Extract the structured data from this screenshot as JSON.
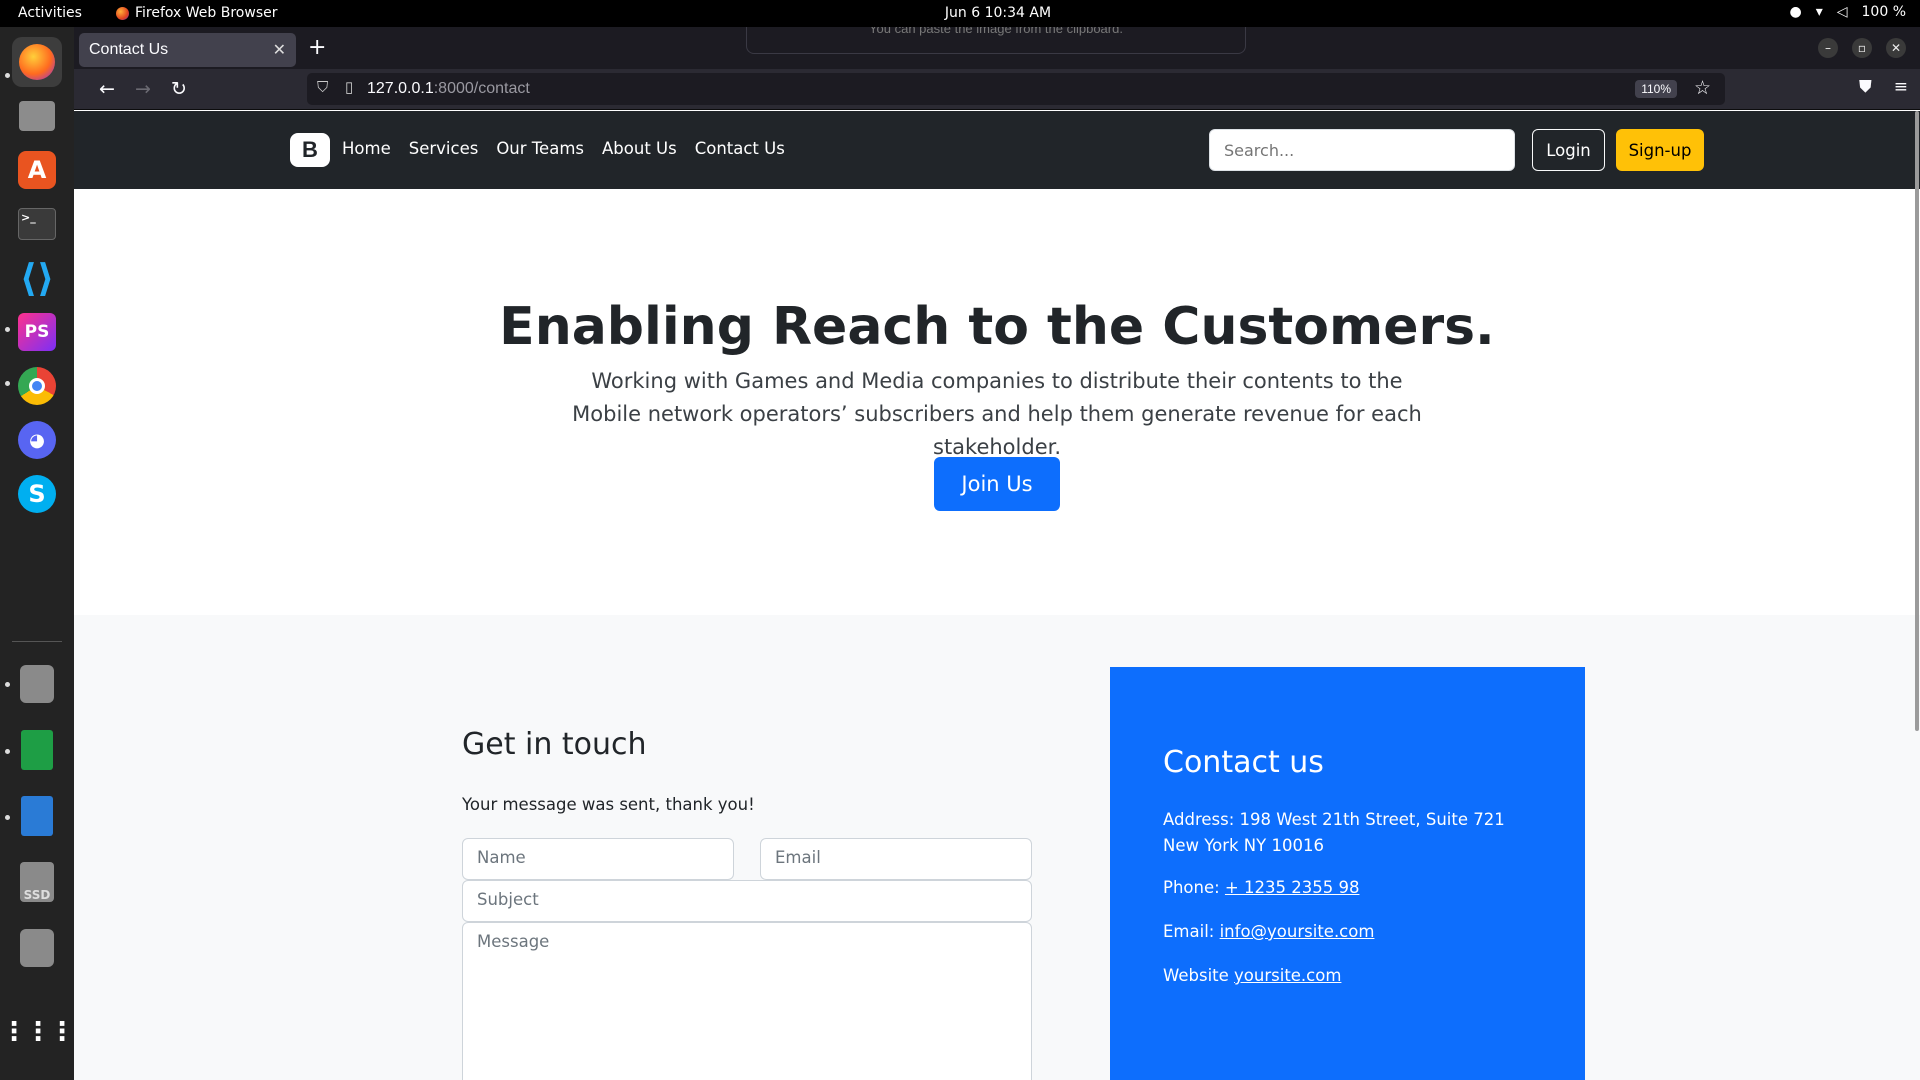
{
  "system": {
    "activities": "Activities",
    "app_name": "Firefox Web Browser",
    "clock": "Jun 6  10:34 AM",
    "battery": "100 %"
  },
  "browser": {
    "tab_title": "Contact Us",
    "paste_hint": "You can paste the image from the clipboard.",
    "url_host": "127.0.0.1",
    "url_path": ":8000/contact",
    "zoom": "110%"
  },
  "site": {
    "brand": "B",
    "nav": [
      "Home",
      "Services",
      "Our Teams",
      "About Us",
      "Contact Us"
    ],
    "search_placeholder": "Search...",
    "login": "Login",
    "signup": "Sign-up"
  },
  "hero": {
    "title": "Enabling Reach to the Customers.",
    "subtitle": "Working with Games and Media companies to distribute their contents to the Mobile network operators’ subscribers and help them generate revenue for each stakeholder.",
    "cta": "Join Us"
  },
  "form": {
    "title": "Get in touch",
    "status": "Your message was sent, thank you!",
    "name_placeholder": "Name",
    "email_placeholder": "Email",
    "subject_placeholder": "Subject",
    "message_placeholder": "Message"
  },
  "contact": {
    "title": "Contact us",
    "address_label": "Address:",
    "address": "198 West 21th Street, Suite 721 New York NY 10016",
    "phone_label": "Phone:",
    "phone": "+ 1235 2355 98",
    "email_label": "Email:",
    "email": "info@yoursite.com",
    "website_label": "Website",
    "website": "yoursite.com"
  },
  "colors": {
    "primary": "#0d6efd",
    "warning": "#ffc107",
    "dark": "#212529"
  }
}
